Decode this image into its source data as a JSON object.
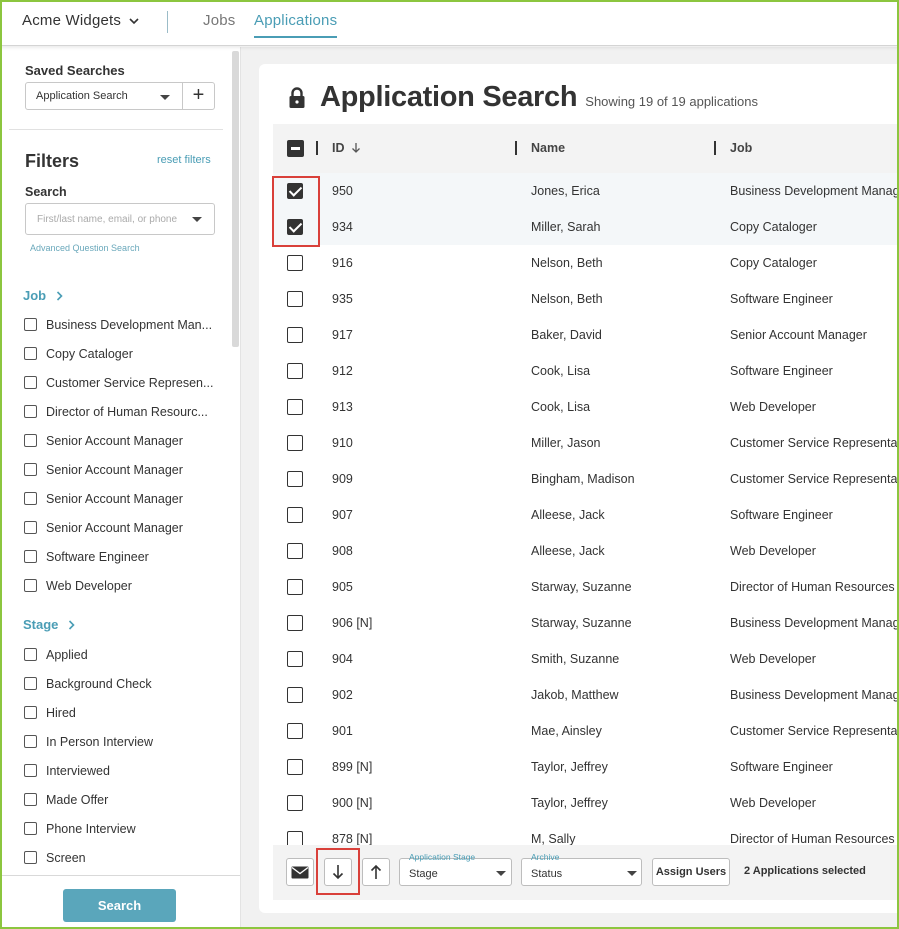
{
  "topbar": {
    "org_name": "Acme Widgets",
    "tabs": [
      {
        "label": "Jobs",
        "active": false
      },
      {
        "label": "Applications",
        "active": true
      }
    ]
  },
  "sidebar": {
    "saved_searches_label": "Saved Searches",
    "saved_search_value": "Application Search",
    "add_icon": "plus-icon",
    "filters_title": "Filters",
    "reset_filters": "reset filters",
    "search_label": "Search",
    "search_placeholder": "First/last name, email, or phone",
    "advanced_search": "Advanced Question Search",
    "job_section": {
      "title": "Job",
      "items": [
        "Business Development Man...",
        "Copy Cataloger",
        "Customer Service Represen...",
        "Director of Human Resourc...",
        "Senior Account Manager",
        "Senior Account Manager",
        "Senior Account Manager",
        "Senior Account Manager",
        "Software Engineer",
        "Web Developer"
      ]
    },
    "stage_section": {
      "title": "Stage",
      "items": [
        "Applied",
        "Background Check",
        "Hired",
        "In Person Interview",
        "Interviewed",
        "Made Offer",
        "Phone Interview",
        "Screen"
      ]
    },
    "search_button": "Search"
  },
  "main": {
    "title": "Application Search",
    "subtitle": "Showing 19 of 19 applications",
    "columns": {
      "id": "ID",
      "name": "Name",
      "job": "Job"
    },
    "rows": [
      {
        "id": "950",
        "name": "Jones, Erica",
        "job": "Business Development Manager",
        "selected": true
      },
      {
        "id": "934",
        "name": "Miller, Sarah",
        "job": "Copy Cataloger",
        "selected": true
      },
      {
        "id": "916",
        "name": "Nelson, Beth",
        "job": "Copy Cataloger",
        "selected": false
      },
      {
        "id": "935",
        "name": "Nelson, Beth",
        "job": "Software Engineer",
        "selected": false
      },
      {
        "id": "917",
        "name": "Baker, David",
        "job": "Senior Account Manager",
        "selected": false
      },
      {
        "id": "912",
        "name": "Cook, Lisa",
        "job": "Software Engineer",
        "selected": false
      },
      {
        "id": "913",
        "name": "Cook, Lisa",
        "job": "Web Developer",
        "selected": false
      },
      {
        "id": "910",
        "name": "Miller, Jason",
        "job": "Customer Service Representative",
        "selected": false
      },
      {
        "id": "909",
        "name": "Bingham, Madison",
        "job": "Customer Service Representative",
        "selected": false
      },
      {
        "id": "907",
        "name": "Alleese, Jack",
        "job": "Software Engineer",
        "selected": false
      },
      {
        "id": "908",
        "name": "Alleese, Jack",
        "job": "Web Developer",
        "selected": false
      },
      {
        "id": "905",
        "name": "Starway, Suzanne",
        "job": "Director of Human Resources",
        "selected": false
      },
      {
        "id": "906 [N]",
        "name": "Starway, Suzanne",
        "job": "Business Development Manager",
        "selected": false
      },
      {
        "id": "904",
        "name": "Smith, Suzanne",
        "job": "Web Developer",
        "selected": false
      },
      {
        "id": "902",
        "name": "Jakob, Matthew",
        "job": "Business Development Manager",
        "selected": false
      },
      {
        "id": "901",
        "name": "Mae, Ainsley",
        "job": "Customer Service Representative",
        "selected": false
      },
      {
        "id": "899 [N]",
        "name": "Taylor, Jeffrey",
        "job": "Software Engineer",
        "selected": false
      },
      {
        "id": "900 [N]",
        "name": "Taylor, Jeffrey",
        "job": "Web Developer",
        "selected": false
      },
      {
        "id": "878 [N]",
        "name": "M, Sally",
        "job": "Director of Human Resources",
        "selected": false
      }
    ]
  },
  "actionbar": {
    "stage_float_label": "Application Stage",
    "stage_value": "Stage",
    "archive_float_label": "Archive",
    "archive_value": "Status",
    "assign_users": "Assign Users",
    "selected_count": "2 Applications selected"
  }
}
